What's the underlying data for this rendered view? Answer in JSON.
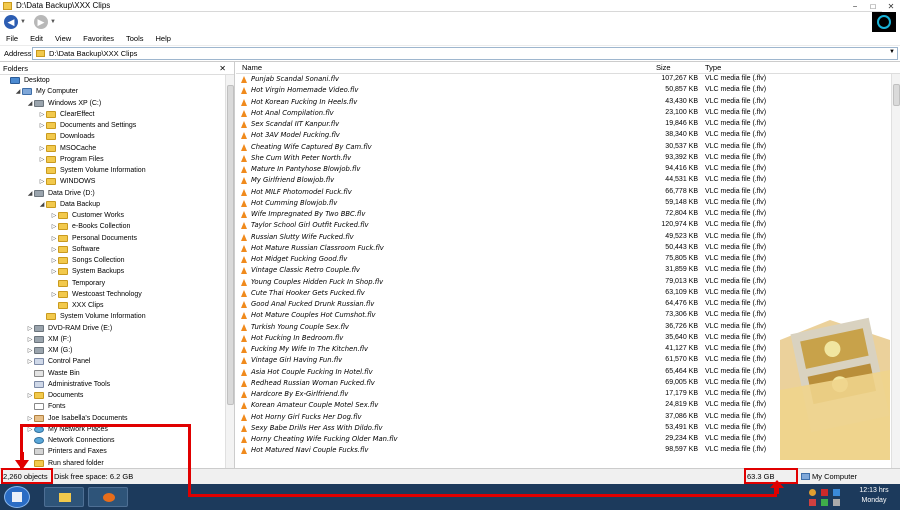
{
  "window": {
    "title": "D:\\Data Backup\\XXX Clips",
    "controls": [
      "−",
      "□",
      "✕"
    ]
  },
  "nav": {
    "back_icon": "back-arrow-icon",
    "forward_icon": "forward-arrow-icon"
  },
  "menu": [
    "File",
    "Edit",
    "View",
    "Favorites",
    "Tools",
    "Help"
  ],
  "address": {
    "label": "Address",
    "value": "D:\\Data Backup\\XXX Clips"
  },
  "folders_pane": {
    "header": "Folders",
    "close": "✕",
    "tree": [
      {
        "label": "Desktop",
        "level": 0,
        "toggle": "",
        "icon": "desktop"
      },
      {
        "label": "My Computer",
        "level": 1,
        "toggle": "◢",
        "icon": "computer"
      },
      {
        "label": "Windows XP (C:)",
        "level": 2,
        "toggle": "◢",
        "icon": "drive"
      },
      {
        "label": "ClearEffect",
        "level": 3,
        "toggle": "▷",
        "icon": "folder"
      },
      {
        "label": "Documents and Settings",
        "level": 3,
        "toggle": "▷",
        "icon": "folder"
      },
      {
        "label": "Downloads",
        "level": 3,
        "toggle": "",
        "icon": "folder"
      },
      {
        "label": "MSOCache",
        "level": 3,
        "toggle": "▷",
        "icon": "folder"
      },
      {
        "label": "Program Files",
        "level": 3,
        "toggle": "▷",
        "icon": "folder"
      },
      {
        "label": "System Volume Information",
        "level": 3,
        "toggle": "",
        "icon": "folder"
      },
      {
        "label": "WINDOWS",
        "level": 3,
        "toggle": "▷",
        "icon": "folder"
      },
      {
        "label": "Data Drive (D:)",
        "level": 2,
        "toggle": "◢",
        "icon": "drive"
      },
      {
        "label": "Data Backup",
        "level": 3,
        "toggle": "◢",
        "icon": "folder"
      },
      {
        "label": "Customer Works",
        "level": 4,
        "toggle": "▷",
        "icon": "folder"
      },
      {
        "label": "e-Books Collection",
        "level": 4,
        "toggle": "▷",
        "icon": "folder"
      },
      {
        "label": "Personal Documents",
        "level": 4,
        "toggle": "▷",
        "icon": "folder"
      },
      {
        "label": "Software",
        "level": 4,
        "toggle": "▷",
        "icon": "folder"
      },
      {
        "label": "Songs Collection",
        "level": 4,
        "toggle": "▷",
        "icon": "folder"
      },
      {
        "label": "System Backups",
        "level": 4,
        "toggle": "▷",
        "icon": "folder"
      },
      {
        "label": "Temporary",
        "level": 4,
        "toggle": "",
        "icon": "folder"
      },
      {
        "label": "Westcoast Technology",
        "level": 4,
        "toggle": "▷",
        "icon": "folder"
      },
      {
        "label": "XXX Clips",
        "level": 4,
        "toggle": "",
        "icon": "folder"
      },
      {
        "label": "System Volume Information",
        "level": 3,
        "toggle": "",
        "icon": "folder"
      },
      {
        "label": "DVD-RAM Drive (E:)",
        "level": 2,
        "toggle": "▷",
        "icon": "drive"
      },
      {
        "label": "XM (F:)",
        "level": 2,
        "toggle": "▷",
        "icon": "drive"
      },
      {
        "label": "XM (G:)",
        "level": 2,
        "toggle": "▷",
        "icon": "drive"
      },
      {
        "label": "Control Panel",
        "level": 2,
        "toggle": "▷",
        "icon": "panel"
      },
      {
        "label": "Waste Bin",
        "level": 2,
        "toggle": "",
        "icon": "bin"
      },
      {
        "label": "Administrative Tools",
        "level": 2,
        "toggle": "",
        "icon": "panel"
      },
      {
        "label": "Documents",
        "level": 2,
        "toggle": "▷",
        "icon": "folder"
      },
      {
        "label": "Fonts",
        "level": 2,
        "toggle": "",
        "icon": "font"
      },
      {
        "label": "Joe Isabella's Documents",
        "level": 2,
        "toggle": "▷",
        "icon": "user"
      },
      {
        "label": "My Network Places",
        "level": 2,
        "toggle": "▷",
        "icon": "net"
      },
      {
        "label": "Network Connections",
        "level": 2,
        "toggle": "",
        "icon": "net"
      },
      {
        "label": "Printers and Faxes",
        "level": 2,
        "toggle": "",
        "icon": "printer"
      },
      {
        "label": "Run shared folder",
        "level": 2,
        "toggle": "",
        "icon": "folder"
      }
    ]
  },
  "files_pane": {
    "columns": {
      "name": "Name",
      "size": "Size",
      "type": "Type"
    },
    "rows": [
      {
        "name": "Punjab Scandal Sonani.flv",
        "size": "107,267 KB",
        "type": "VLC media file (.flv)"
      },
      {
        "name": "Hot Virgin Homemade Video.flv",
        "size": "50,857 KB",
        "type": "VLC media file (.flv)"
      },
      {
        "name": "Hot Korean Fucking In Heels.flv",
        "size": "43,430 KB",
        "type": "VLC media file (.flv)"
      },
      {
        "name": "Hot Anal Compilation.flv",
        "size": "23,100 KB",
        "type": "VLC media file (.flv)"
      },
      {
        "name": "Sex Scandal IIT Kanpur.flv",
        "size": "19,846 KB",
        "type": "VLC media file (.flv)"
      },
      {
        "name": "Hot 3AV Model Fucking.flv",
        "size": "38,340 KB",
        "type": "VLC media file (.flv)"
      },
      {
        "name": "Cheating Wife Captured By Cam.flv",
        "size": "30,537 KB",
        "type": "VLC media file (.flv)"
      },
      {
        "name": "She Cum With Peter North.flv",
        "size": "93,392 KB",
        "type": "VLC media file (.flv)"
      },
      {
        "name": "Mature In Pantyhose Blowjob.flv",
        "size": "94,416 KB",
        "type": "VLC media file (.flv)"
      },
      {
        "name": "My Girlfriend Blowjob.flv",
        "size": "44,531 KB",
        "type": "VLC media file (.flv)"
      },
      {
        "name": "Hot MILF Photomodel Fuck.flv",
        "size": "66,778 KB",
        "type": "VLC media file (.flv)"
      },
      {
        "name": "Hot Cumming Blowjob.flv",
        "size": "59,148 KB",
        "type": "VLC media file (.flv)"
      },
      {
        "name": "Wife Impregnated By Two BBC.flv",
        "size": "72,804 KB",
        "type": "VLC media file (.flv)"
      },
      {
        "name": "Taylor School Girl Outfit Fucked.flv",
        "size": "120,974 KB",
        "type": "VLC media file (.flv)"
      },
      {
        "name": "Russian Slutty Wife Fucked.flv",
        "size": "49,523 KB",
        "type": "VLC media file (.flv)"
      },
      {
        "name": "Hot Mature Russian Classroom Fuck.flv",
        "size": "50,443 KB",
        "type": "VLC media file (.flv)"
      },
      {
        "name": "Hot Midget Fucking Good.flv",
        "size": "75,805 KB",
        "type": "VLC media file (.flv)"
      },
      {
        "name": "Vintage Classic Retro Couple.flv",
        "size": "31,859 KB",
        "type": "VLC media file (.flv)"
      },
      {
        "name": "Young Couples Hidden Fuck In Shop.flv",
        "size": "79,013 KB",
        "type": "VLC media file (.flv)"
      },
      {
        "name": "Cute Thai Hooker Gets Fucked.flv",
        "size": "63,109 KB",
        "type": "VLC media file (.flv)"
      },
      {
        "name": "Good Anal Fucked Drunk Russian.flv",
        "size": "64,476 KB",
        "type": "VLC media file (.flv)"
      },
      {
        "name": "Hot Mature Couples Hot Cumshot.flv",
        "size": "73,306 KB",
        "type": "VLC media file (.flv)"
      },
      {
        "name": "Turkish Young Couple Sex.flv",
        "size": "36,726 KB",
        "type": "VLC media file (.flv)"
      },
      {
        "name": "Hot Fucking In Bedroom.flv",
        "size": "35,640 KB",
        "type": "VLC media file (.flv)"
      },
      {
        "name": "Fucking My Wife In The Kitchen.flv",
        "size": "41,127 KB",
        "type": "VLC media file (.flv)"
      },
      {
        "name": "Vintage Girl Having Fun.flv",
        "size": "61,570 KB",
        "type": "VLC media file (.flv)"
      },
      {
        "name": "Asia Hot Couple Fucking In Hotel.flv",
        "size": "65,464 KB",
        "type": "VLC media file (.flv)"
      },
      {
        "name": "Redhead Russian Woman Fucked.flv",
        "size": "69,005 KB",
        "type": "VLC media file (.flv)"
      },
      {
        "name": "Hardcore By Ex-Girlfriend.flv",
        "size": "17,179 KB",
        "type": "VLC media file (.flv)"
      },
      {
        "name": "Korean Amateur Couple Motel Sex.flv",
        "size": "24,819 KB",
        "type": "VLC media file (.flv)"
      },
      {
        "name": "Hot Horny Girl Fucks Her Dog.flv",
        "size": "37,086 KB",
        "type": "VLC media file (.flv)"
      },
      {
        "name": "Sexy Babe Drills Her Ass With Dildo.flv",
        "size": "53,491 KB",
        "type": "VLC media file (.flv)"
      },
      {
        "name": "Horny Cheating Wife Fucking Older Man.flv",
        "size": "29,234 KB",
        "type": "VLC media file (.flv)"
      },
      {
        "name": "Hot Matured Navi Couple Fucks.flv",
        "size": "98,597 KB",
        "type": "VLC media file (.flv)"
      }
    ]
  },
  "status": {
    "objects": "2,260 objects",
    "disk_free": "Disk free space: 6.2 GB",
    "total_size": "63.3 GB",
    "location": "My Computer"
  },
  "taskbar": {
    "clock_time": "12:13 hrs",
    "clock_day": "Monday"
  },
  "colors": {
    "annotation": "#e00000",
    "taskbar": "#1c3a5c",
    "vlc_icon": "#f08a1c",
    "folder": "#f2c94c"
  }
}
